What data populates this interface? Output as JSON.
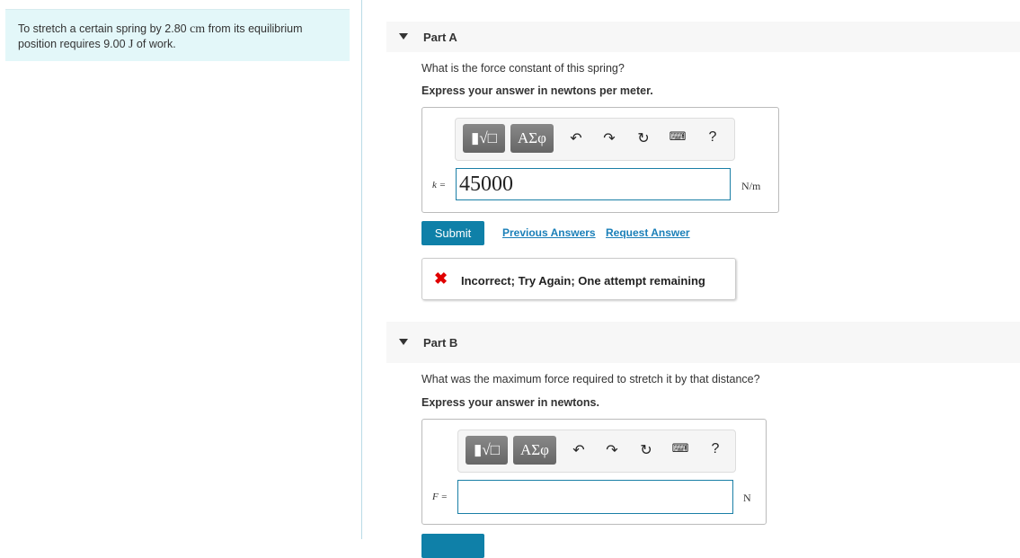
{
  "intro": {
    "text_before": "To stretch a certain spring by 2.80 ",
    "unit1": "cm",
    "text_mid": " from its equilibrium position requires 9.00 ",
    "unit2": "J",
    "text_after": " of work."
  },
  "partA": {
    "title": "Part A",
    "question": "What is the force constant of this spring?",
    "instruction": "Express your answer in newtons per meter.",
    "toolbar": {
      "templates": "▮√□",
      "greek": "ΑΣφ",
      "help": "?"
    },
    "var_label": "k =",
    "value": "45000",
    "unit": "N/m",
    "submit": "Submit",
    "previous_answers": "Previous Answers",
    "request_answer": "Request Answer",
    "feedback": "Incorrect; Try Again; One attempt remaining"
  },
  "partB": {
    "title": "Part B",
    "question": "What was the maximum force required to stretch it by that distance?",
    "instruction": "Express your answer in newtons.",
    "toolbar": {
      "templates": "▮√□",
      "greek": "ΑΣφ",
      "help": "?"
    },
    "var_label": "F =",
    "value": "",
    "unit": "N"
  },
  "colors": {
    "accent": "#0f80a8",
    "error": "#e00000",
    "intro_bg": "#e3f7f9"
  }
}
